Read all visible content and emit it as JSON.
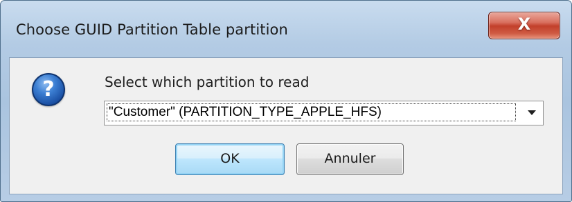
{
  "window": {
    "title": "Choose GUID Partition Table partition",
    "close_glyph": "X"
  },
  "dialog": {
    "icon": "question-icon",
    "icon_glyph": "?",
    "prompt": "Select which partition to read",
    "partition_select": {
      "selected_value": "\"Customer\" (PARTITION_TYPE_APPLE_HFS)"
    },
    "ok_label": "OK",
    "cancel_label": "Annuler"
  },
  "colors": {
    "titlebar": "#b3cbe4",
    "close_button": "#c2402b",
    "icon_blue": "#1a4fa3",
    "default_button_border": "#3c7fb1"
  }
}
